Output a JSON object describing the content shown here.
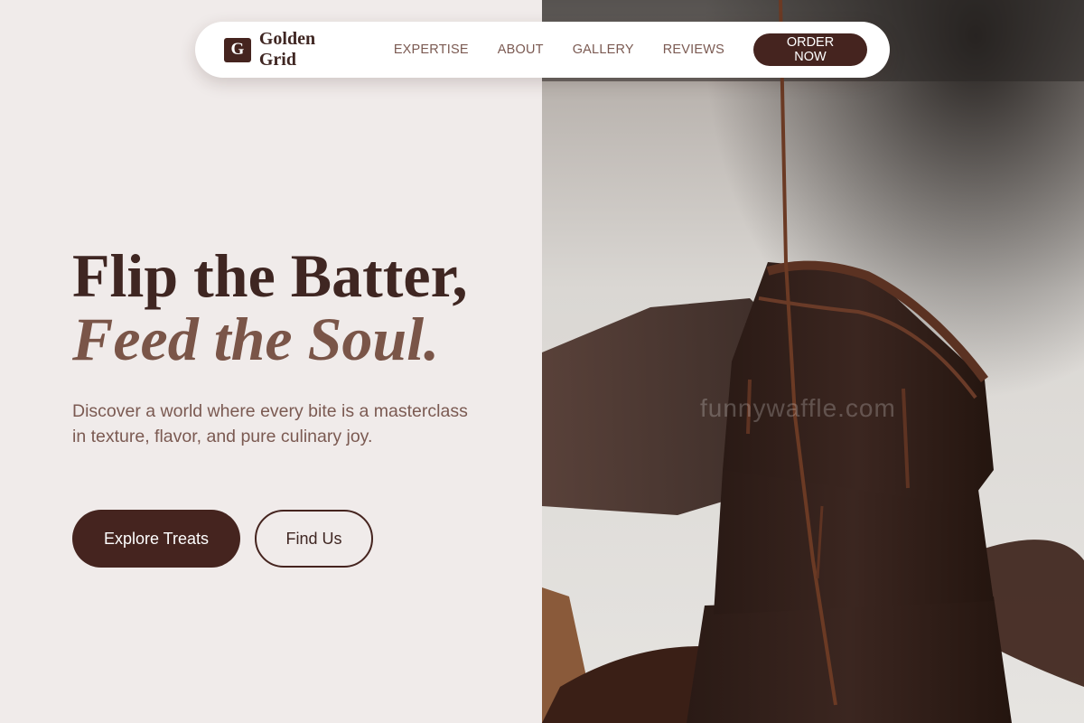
{
  "brand": {
    "mark": "G",
    "name": "Golden Grid"
  },
  "nav": {
    "links": [
      "EXPERTISE",
      "ABOUT",
      "GALLERY",
      "REVIEWS"
    ],
    "cta": "ORDER NOW"
  },
  "hero": {
    "title_line1": "Flip the Batter,",
    "title_line2": "Feed the Soul.",
    "subtitle": "Discover a world where every bite is a masterclass in texture, flavor, and pure culinary joy.",
    "primary_button": "Explore Treats",
    "secondary_button": "Find Us"
  },
  "image": {
    "watermark": "funnywaffle.com",
    "subject": "stacked-chocolate-brownies-photo"
  },
  "colors": {
    "accent": "#45241f",
    "text_dark": "#3f2622",
    "text_muted": "#7b5a52",
    "panel_bg": "#f0ebea"
  }
}
